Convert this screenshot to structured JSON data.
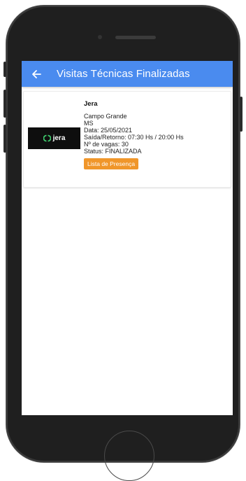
{
  "appbar": {
    "title": "Visitas Técnicas Finalizadas"
  },
  "visit": {
    "logo_text": "jera",
    "name": "Jera",
    "city": "Campo Grande",
    "state": "MS",
    "date": "Data: 25/05/2021",
    "schedule": "Saída/Retorno: 07:30 Hs / 20:00 Hs",
    "vacancies": "Nº de vagas: 30",
    "status": "Status: FINALIZADA",
    "button_label": "Lista de Presença"
  },
  "colors": {
    "appbar": "#4a8bef",
    "button": "#f0962a",
    "logo_bg": "#0e0e0e",
    "logo_accent": "#3ec96b"
  }
}
